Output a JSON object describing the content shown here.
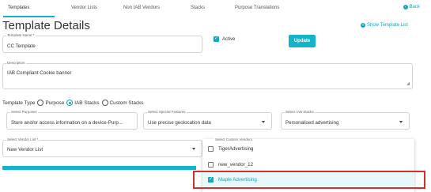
{
  "tabs": {
    "items": [
      "Templates",
      "Vendor Lists",
      "Non IAB Vendors",
      "Stacks",
      "Purpose Translations"
    ],
    "active_index": 0,
    "back_label": "Back"
  },
  "page": {
    "title": "Template Details",
    "show_list_label": "Show Template List"
  },
  "form": {
    "template_name": {
      "label": "Template Name *",
      "value": "CC Template"
    },
    "active": {
      "label": "Active",
      "checked": true
    },
    "update_label": "Update",
    "description": {
      "label": "Description",
      "value": "IAB Compliant Cookie banner"
    },
    "template_type": {
      "label": "Template Type",
      "options": [
        "Purpose",
        "IAB Stacks",
        "Custom Stacks"
      ],
      "selected": "IAB Stacks"
    },
    "select_purposes": {
      "label": "Select Purposes",
      "value": "Store and/or access information on a device-Purp..."
    },
    "select_special_features": {
      "label": "Select Special Features",
      "value": "Use precise geolocation data"
    },
    "select_iab_stacks": {
      "label": "Select IAB Stacks",
      "value": "Personalised advertising"
    },
    "select_vendor_list": {
      "label": "Select Vendor List *",
      "value": "New Vendor List"
    },
    "select_custom_vendors": {
      "label": "Select Custom Vendors",
      "options": [
        {
          "label": "TigerAdvertising",
          "checked": false
        },
        {
          "label": "new_vendor_12",
          "checked": false
        },
        {
          "label": "Maple Advertising",
          "checked": true
        }
      ]
    }
  },
  "colors": {
    "accent": "#13b3c9",
    "link": "#13a6bf",
    "highlight": "#d32f2f"
  }
}
